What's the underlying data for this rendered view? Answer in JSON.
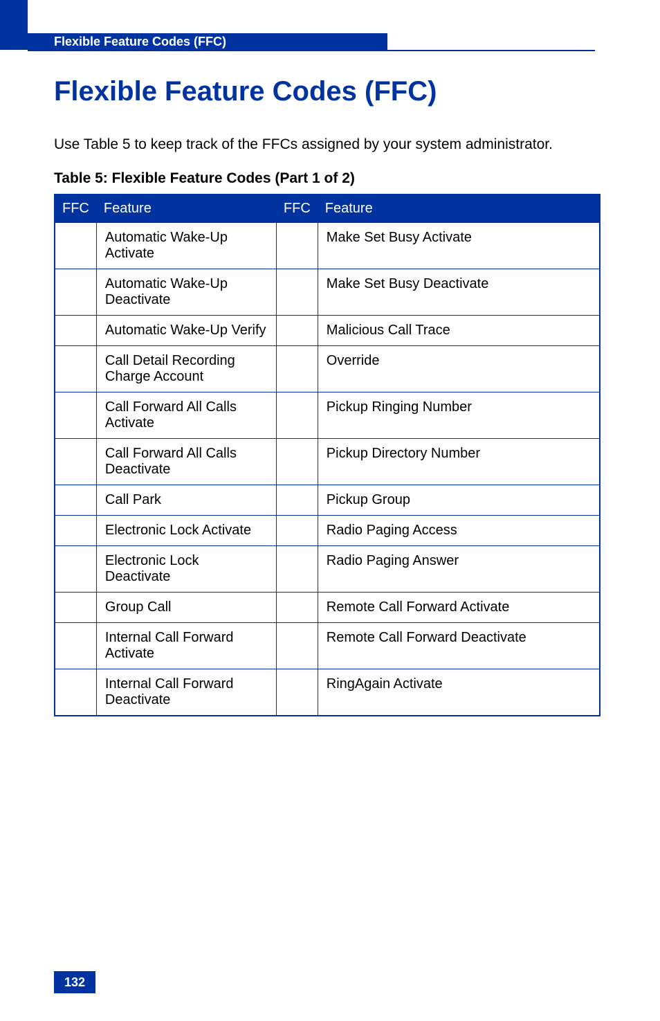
{
  "header": {
    "section_label": "Flexible Feature Codes (FFC)"
  },
  "title": "Flexible Feature Codes (FFC)",
  "intro": "Use Table 5 to keep track of the FFCs assigned by your system administrator.",
  "table_caption": "Table 5: Flexible Feature Codes  (Part 1 of 2)",
  "table": {
    "headers": {
      "c1": "FFC",
      "c2": "Feature",
      "c3": "FFC",
      "c4": "Feature"
    },
    "rows": [
      {
        "f1": "Automatic Wake-Up Activate",
        "f2": "Make Set Busy Activate"
      },
      {
        "f1": "Automatic Wake-Up Deactivate",
        "f2": "Make Set Busy Deactivate"
      },
      {
        "f1": "Automatic Wake-Up Verify",
        "f2": "Malicious Call Trace"
      },
      {
        "f1": "Call Detail Recording Charge Account",
        "f2": "Override"
      },
      {
        "f1": "Call Forward All Calls Activate",
        "f2": "Pickup Ringing Number"
      },
      {
        "f1": "Call Forward All Calls Deactivate",
        "f2": "Pickup Directory Number"
      },
      {
        "f1": "Call Park",
        "f2": "Pickup Group"
      },
      {
        "f1": "Electronic Lock Activate",
        "f2": "Radio Paging Access"
      },
      {
        "f1": "Electronic Lock Deactivate",
        "f2": "Radio Paging Answer"
      },
      {
        "f1": "Group Call",
        "f2": "Remote Call Forward Activate"
      },
      {
        "f1": "Internal Call Forward Activate",
        "f2": "Remote Call Forward Deactivate"
      },
      {
        "f1": "Internal Call Forward Deactivate",
        "f2": "RingAgain Activate"
      }
    ]
  },
  "page_number": "132"
}
